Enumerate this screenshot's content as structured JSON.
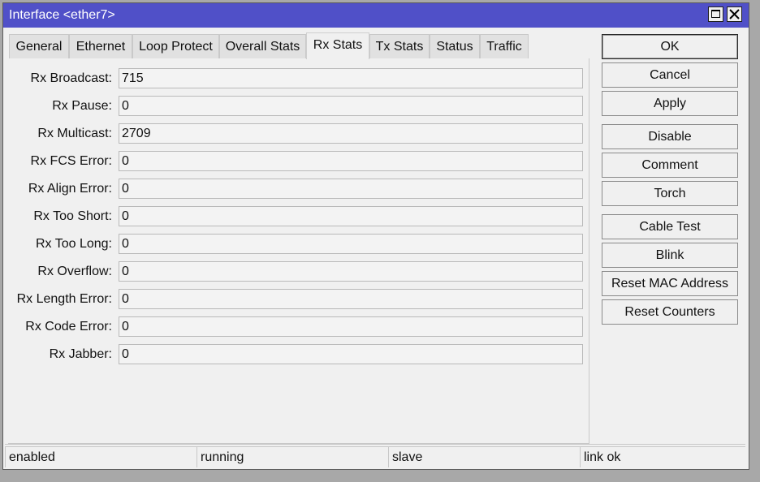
{
  "window": {
    "title": "Interface <ether7>"
  },
  "tabs": [
    {
      "label": "General"
    },
    {
      "label": "Ethernet"
    },
    {
      "label": "Loop Protect"
    },
    {
      "label": "Overall Stats"
    },
    {
      "label": "Rx Stats",
      "active": true
    },
    {
      "label": "Tx Stats"
    },
    {
      "label": "Status"
    },
    {
      "label": "Traffic"
    }
  ],
  "fields": [
    {
      "label": "Rx Broadcast:",
      "value": "715"
    },
    {
      "label": "Rx Pause:",
      "value": "0"
    },
    {
      "label": "Rx Multicast:",
      "value": "2709"
    },
    {
      "label": "Rx FCS Error:",
      "value": "0"
    },
    {
      "label": "Rx Align Error:",
      "value": "0"
    },
    {
      "label": "Rx Too Short:",
      "value": "0"
    },
    {
      "label": "Rx Too Long:",
      "value": "0"
    },
    {
      "label": "Rx Overflow:",
      "value": "0"
    },
    {
      "label": "Rx Length Error:",
      "value": "0"
    },
    {
      "label": "Rx Code Error:",
      "value": "0"
    },
    {
      "label": "Rx Jabber:",
      "value": "0"
    }
  ],
  "buttons": {
    "ok": "OK",
    "cancel": "Cancel",
    "apply": "Apply",
    "disable": "Disable",
    "comment": "Comment",
    "torch": "Torch",
    "cable_test": "Cable Test",
    "blink": "Blink",
    "reset_mac": "Reset MAC Address",
    "reset_counters": "Reset Counters"
  },
  "status": [
    "enabled",
    "running",
    "slave",
    "link ok"
  ],
  "colors": {
    "titlebar": "#5050c8",
    "window_bg": "#f0f0f0"
  }
}
